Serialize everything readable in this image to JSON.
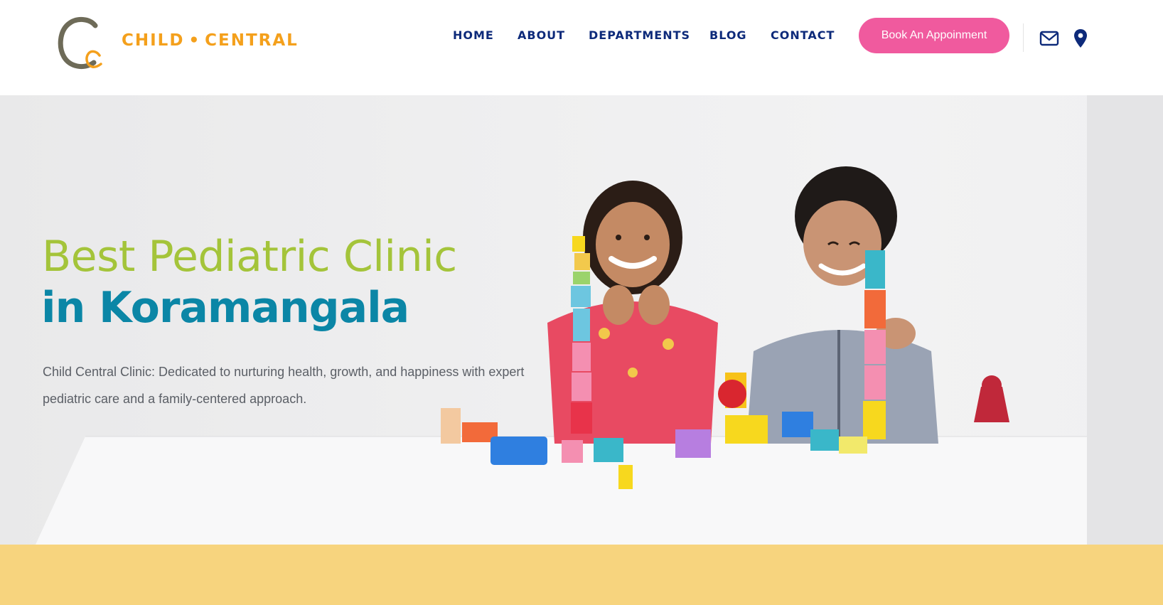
{
  "brand": {
    "name_left": "CHILD",
    "separator": "•",
    "name_right": "CENTRAL",
    "logo_letters": "Cc",
    "colors": {
      "olive": "#6e6b58",
      "orange": "#f4a01c"
    }
  },
  "nav": {
    "items": [
      {
        "label": "HOME"
      },
      {
        "label": "ABOUT"
      },
      {
        "label": "DEPARTMENTS"
      },
      {
        "label": "BLOG"
      },
      {
        "label": "CONTACT"
      }
    ],
    "cta_label": "Book An Appoinment",
    "icons": [
      "envelope-icon",
      "map-pin-icon"
    ]
  },
  "hero": {
    "title_line1": "Best Pediatric Clinic",
    "title_line2": "in Koramangala",
    "description": "Child Central Clinic: Dedicated to nurturing health, growth, and happiness with expert pediatric care and a family-centered approach."
  },
  "colors": {
    "nav_text": "#0d2a7a",
    "cta": "#f05a9e",
    "title_green": "#a4c43a",
    "title_teal": "#0b86a6",
    "band": "#f7d47e"
  }
}
